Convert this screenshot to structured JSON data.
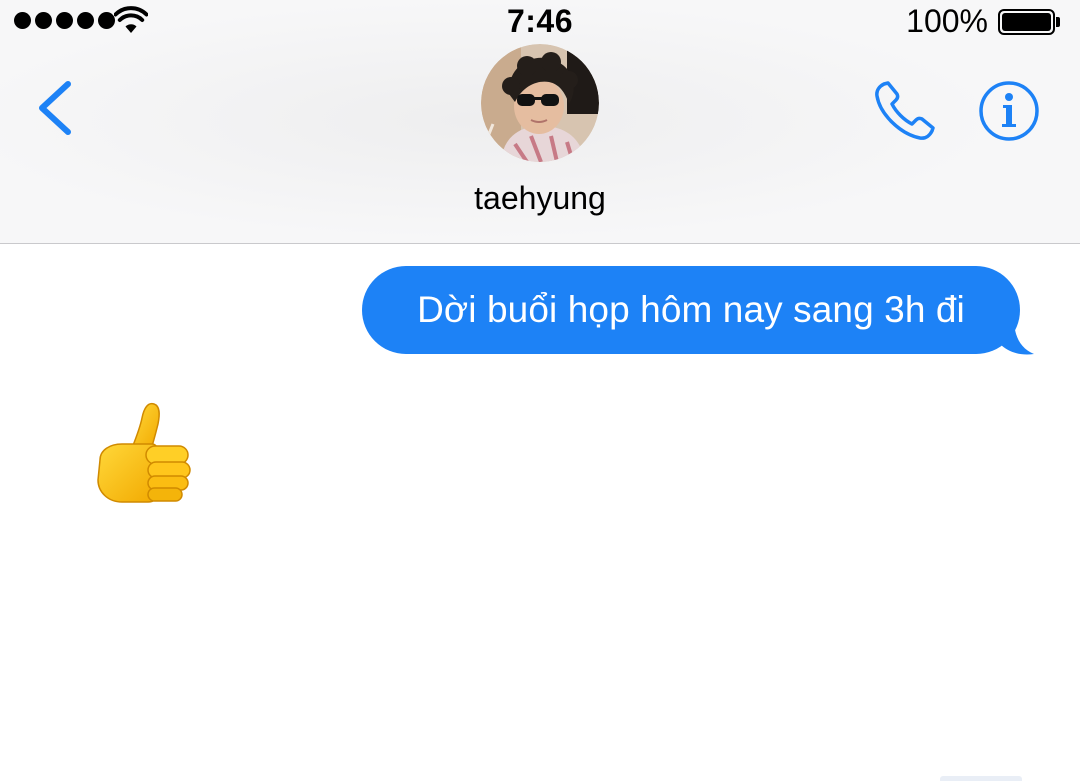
{
  "status_bar": {
    "time": "7:46",
    "battery_percent": "100%",
    "signal_bars": 5,
    "wifi_icon": "wifi-icon",
    "battery_icon": "battery-icon"
  },
  "nav": {
    "back_icon": "chevron-left-icon",
    "contact_name": "taehyung",
    "call_icon": "phone-icon",
    "info_icon": "info-icon"
  },
  "messages": [
    {
      "direction": "outgoing",
      "text": "Dời buổi họp hôm nay sang 3h đi"
    },
    {
      "direction": "incoming",
      "emoji": "thumbs-up",
      "icon": "thumbs-up-icon"
    }
  ],
  "colors": {
    "accent": "#1d82f6",
    "header_bg": "#f7f7f8",
    "bubble_text": "#ffffff"
  }
}
